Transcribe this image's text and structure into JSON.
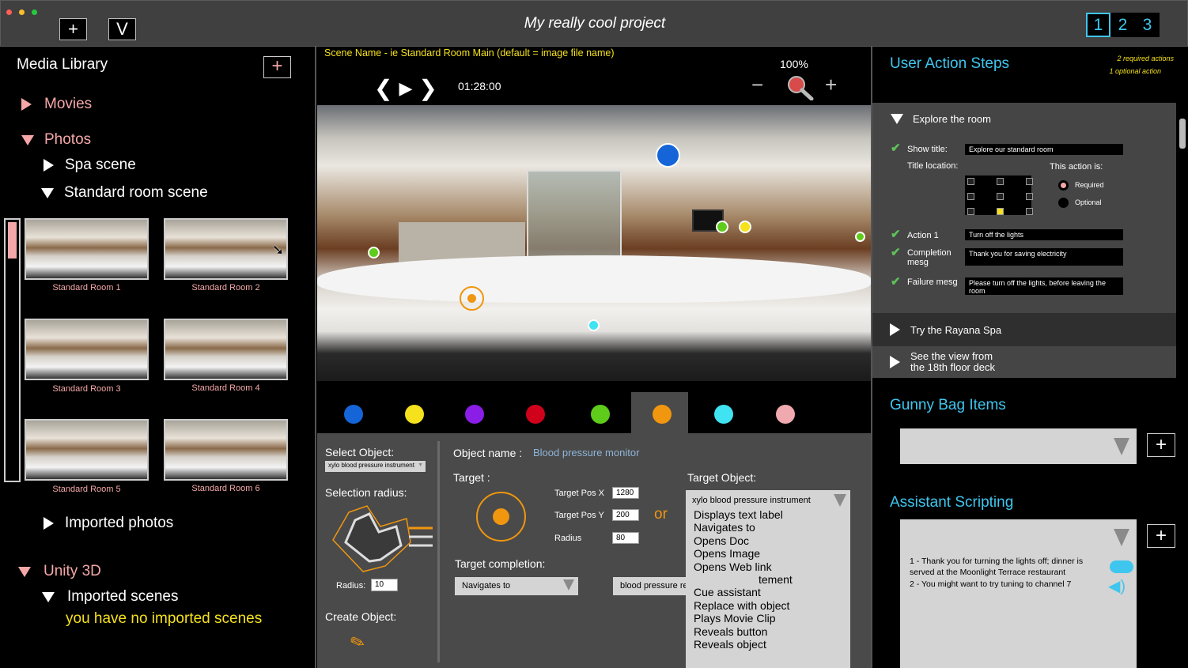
{
  "window": {
    "title": "My really cool project",
    "btn_add": "+",
    "btn_v": "V",
    "pages": [
      "1",
      "2",
      "3"
    ],
    "selected_page": "1",
    "traffic_lights": [
      "#ff5f57",
      "#ffbd2e",
      "#28c940"
    ]
  },
  "library": {
    "title": "Media Library",
    "add": "+",
    "movies": "Movies",
    "photos": "Photos",
    "spa": "Spa scene",
    "standard": "Standard room scene",
    "thumbs": [
      "Standard Room 1",
      "Standard Room 2",
      "Standard Room 3",
      "Standard Room 4",
      "Standard Room 5",
      "Standard Room 6"
    ],
    "imported_photos": "Imported photos",
    "unity": "Unity 3D",
    "imported_scenes": "Imported scenes",
    "no_scenes": "you have no imported scenes"
  },
  "viewer": {
    "scene_name": "Scene Name - ie Standard Room Main (default = image file name)",
    "zoom": "100%",
    "time": "01:28:00",
    "prev_icon": "chevron-left-icon",
    "play_icon": "play-icon",
    "next_icon": "chevron-right-icon",
    "zoom_out": "−",
    "zoom_in": "+"
  },
  "swatches": [
    "#1565d8",
    "#f5e11c",
    "#8a1de6",
    "#d0021b",
    "#5fcb1b",
    "#f0960f",
    "#3fe3f2",
    "#f1a9b0"
  ],
  "selected_swatch": "#f0960f",
  "editor": {
    "select_object_label": "Select Object:",
    "select_object_value": "xylo blood pressure instrument",
    "selection_radius_label": "Selection radius:",
    "radius_label": "Radius:",
    "radius_value": "10",
    "create_object_label": "Create Object:",
    "object_name_label": "Object name :",
    "object_name_value": "Blood pressure monitor",
    "target_label": "Target :",
    "pos_x_label": "Target Pos X",
    "pos_x": "1280",
    "pos_y_label": "Target Pos Y",
    "pos_y": "200",
    "radius2_label": "Radius",
    "radius2": "80",
    "or": "or",
    "target_completion_label": "Target completion:",
    "completion_value": "Navigates to",
    "completion_target": "blood pressure reading test",
    "target_object_label": "Target Object:",
    "target_object_value": "xylo blood pressure instrument",
    "options": [
      "Displays text label",
      "Navigates to",
      "Opens Doc",
      "Opens Image",
      "Opens Web link",
      "tement",
      "Cue assistant",
      "Replace with object",
      "Plays Movie Clip",
      "Reveals button",
      "Reveals object"
    ]
  },
  "steps": {
    "title": "User Action Steps",
    "req_note": "2 required actions",
    "opt_note": "1 optional action",
    "explore": "Explore the room",
    "show_title_label": "Show title:",
    "show_title_value": "Explore our standard room",
    "title_location_label": "Title location:",
    "action_is_label": "This action is:",
    "required": "Required",
    "optional": "Optional",
    "action1_label": "Action 1",
    "action1_value": "Turn off the lights",
    "completion_label": "Completion mesg",
    "completion_value": "Thank you for saving electricity",
    "failure_label": "Failure mesg",
    "failure_value": "Please turn off the lights, before leaving the room",
    "spa": "Try the Rayana Spa",
    "view": "See the view from the 18th floor deck"
  },
  "gunny": {
    "title": "Gunny Bag Items",
    "add": "+"
  },
  "assistant": {
    "title": "Assistant Scripting",
    "add": "+",
    "line1": "1 - Thank you for turning the lights off; dinner is served at the Moonlight Terrace restaurant",
    "line2": "2 - You might want to try tuning to channel 7"
  }
}
